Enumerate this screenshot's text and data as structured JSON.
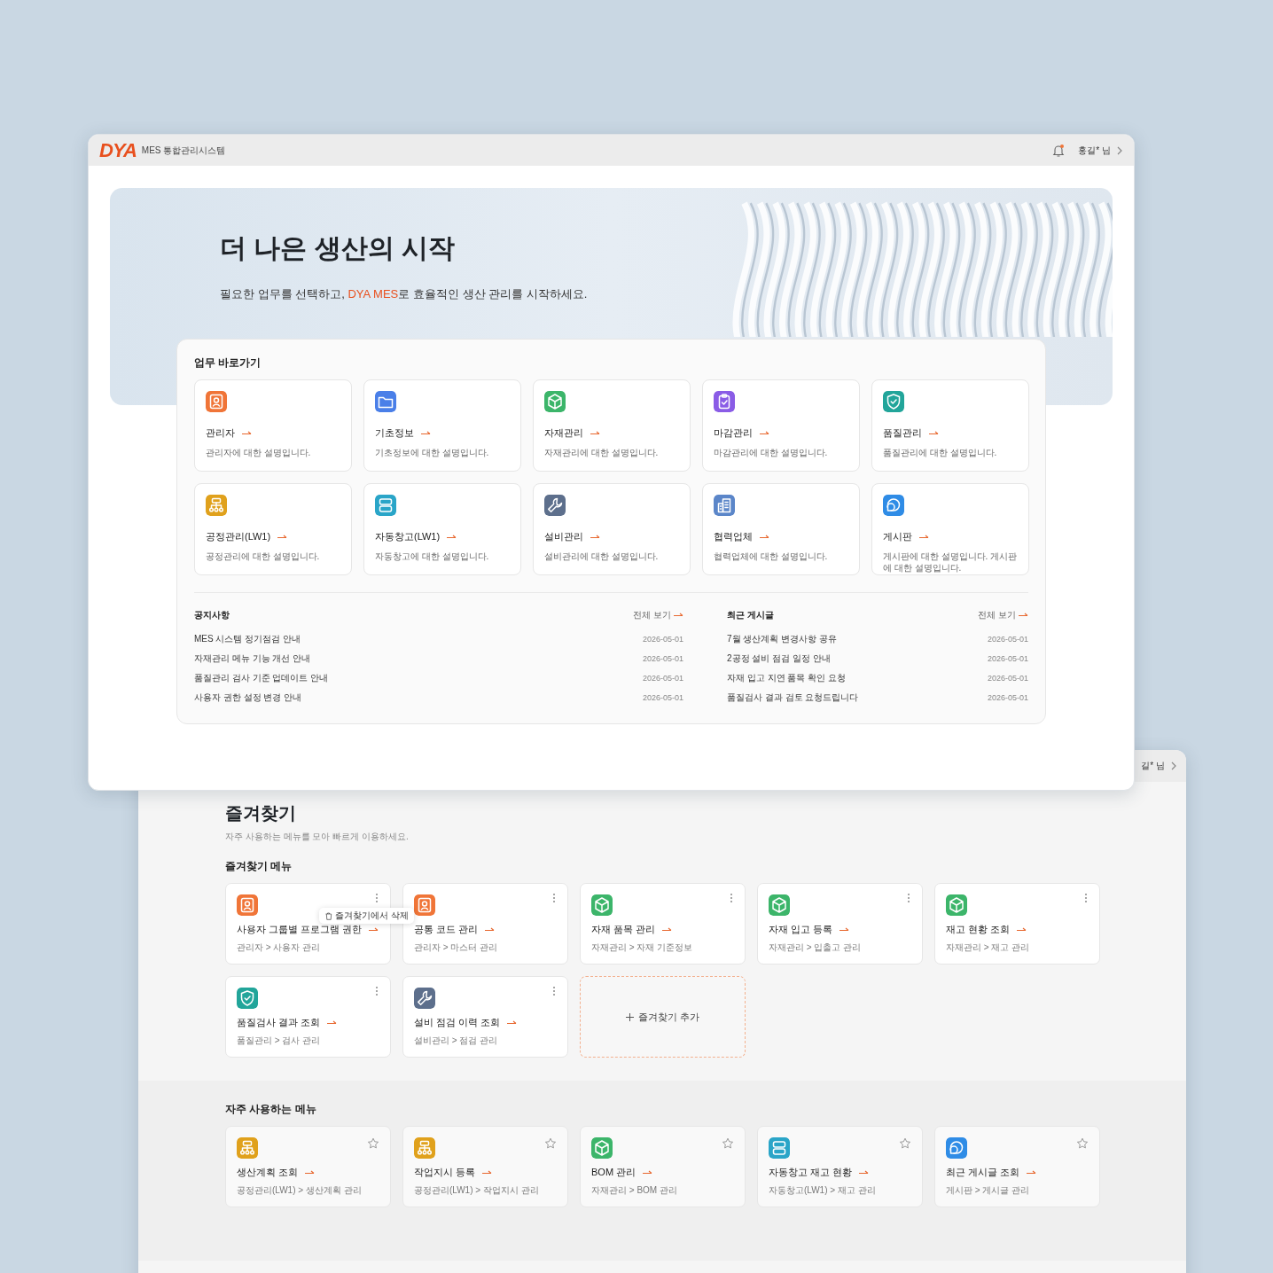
{
  "main_window": {
    "logo": "DYA",
    "app_title": "MES 통합관리시스템",
    "user": "홍길* 님",
    "unread": true,
    "hero": {
      "title": "더 나은 생산의 시작",
      "subtitle": [
        {
          "text": "필요한 업무를 선택하고, ",
          "highlight": false
        },
        {
          "text": "DYA MES",
          "highlight": true
        },
        {
          "text": "로 효율적인 생산 관리를 시작하세요.",
          "highlight": false
        }
      ]
    },
    "quick_links": {
      "title": "업무 바로가기",
      "items": [
        {
          "kind": "admin",
          "color": "#f07538",
          "label": "관리자",
          "desc": "관리자에 대한 설명입니다."
        },
        {
          "kind": "basic",
          "color": "#4a7fe8",
          "label": "기초정보",
          "desc": "기초정보에 대한 설명입니다."
        },
        {
          "kind": "material",
          "color": "#3cb56a",
          "label": "자재관리",
          "desc": "자재관리에 대한 설명입니다."
        },
        {
          "kind": "closing",
          "color": "#8a5ce6",
          "label": "마감관리",
          "desc": "마감관리에 대한 설명입니다."
        },
        {
          "kind": "quality",
          "color": "#22a59a",
          "label": "품질관리",
          "desc": "품질관리에 대한 설명입니다."
        },
        {
          "kind": "process",
          "color": "#e0a11c",
          "label": "공정관리(LW1)",
          "desc": "공정관리에 대한 설명입니다."
        },
        {
          "kind": "warehouse",
          "color": "#2aa5c8",
          "label": "자동창고(LW1)",
          "desc": "자동창고에 대한 설명입니다."
        },
        {
          "kind": "equipment",
          "color": "#5d6f8c",
          "label": "설비관리",
          "desc": "설비관리에 대한 설명입니다."
        },
        {
          "kind": "partner",
          "color": "#5b86c9",
          "label": "협력업체",
          "desc": "협력업체에 대한 설명입니다."
        },
        {
          "kind": "board",
          "color": "#2f8ce6",
          "label": "게시판",
          "desc": "게시판에 대한 설명입니다. 게시판에 대한 설명입니다."
        }
      ]
    },
    "boards": [
      {
        "title": "공지사항",
        "view_all": "전체 보기",
        "posts": [
          {
            "title": "MES 시스템 정기점검 안내",
            "date": "2026-05-01"
          },
          {
            "title": "자재관리 메뉴 기능 개선 안내",
            "date": "2026-05-01"
          },
          {
            "title": "품질관리 검사 기준 업데이트 안내",
            "date": "2026-05-01"
          },
          {
            "title": "사용자 권한 설정 변경 안내",
            "date": "2026-05-01"
          }
        ]
      },
      {
        "title": "최근 게시글",
        "view_all": "전체 보기",
        "posts": [
          {
            "title": "7월 생산계획 변경사항 공유",
            "date": "2026-05-01"
          },
          {
            "title": "2공정 설비 점검 일정 안내",
            "date": "2026-05-01"
          },
          {
            "title": "자재 입고 지연 품목 확인 요청",
            "date": "2026-05-01"
          },
          {
            "title": "품질검사 결과 검토 요청드립니다",
            "date": "2026-05-01"
          }
        ]
      }
    ]
  },
  "back_window": {
    "user": "길* 님",
    "favorites": {
      "title": "즐겨찾기",
      "subtitle": "자주 사용하는 메뉴를 모아 빠르게 이용하세요.",
      "section_title": "즐겨찾기 메뉴",
      "add_label": "즐겨찾기 추가",
      "items": [
        {
          "kind": "admin",
          "color": "#f07538",
          "label": "사용자 그룹별 프로그램 권한",
          "path": "관리자 > 사용자 관리",
          "menu": "즐겨찾기에서 삭제"
        },
        {
          "kind": "admin",
          "color": "#f07538",
          "label": "공통 코드 관리",
          "path": "관리자 > 마스터 관리"
        },
        {
          "kind": "material",
          "color": "#3cb56a",
          "label": "자재 품목 관리",
          "path": "자재관리 > 자재 기준정보"
        },
        {
          "kind": "material",
          "color": "#3cb56a",
          "label": "자재 입고 등록",
          "path": "자재관리 > 입출고 관리"
        },
        {
          "kind": "material",
          "color": "#3cb56a",
          "label": "재고 현황 조회",
          "path": "자재관리 > 재고 관리"
        },
        {
          "kind": "quality",
          "color": "#22a59a",
          "label": "품질검사 결과 조회",
          "path": "품질관리 > 검사 관리"
        },
        {
          "kind": "equipment",
          "color": "#5d6f8c",
          "label": "설비 점검 이력 조회",
          "path": "설비관리 > 점검 관리"
        }
      ]
    },
    "frequent": {
      "title": "자주 사용하는 메뉴",
      "items": [
        {
          "kind": "process",
          "color": "#e0a11c",
          "label": "생산계획 조회",
          "path": "공정관리(LW1) > 생산계획 관리"
        },
        {
          "kind": "process",
          "color": "#e0a11c",
          "label": "작업지시 등록",
          "path": "공정관리(LW1) > 작업지시 관리"
        },
        {
          "kind": "material",
          "color": "#3cb56a",
          "label": "BOM 관리",
          "path": "자재관리 > BOM 관리"
        },
        {
          "kind": "warehouse",
          "color": "#2aa5c8",
          "label": "자동창고 재고 현황",
          "path": "자동창고(LW1) > 재고 관리"
        },
        {
          "kind": "board",
          "color": "#2f8ce6",
          "label": "최근 게시글 조회",
          "path": "게시판 > 게시글 관리"
        }
      ]
    }
  }
}
